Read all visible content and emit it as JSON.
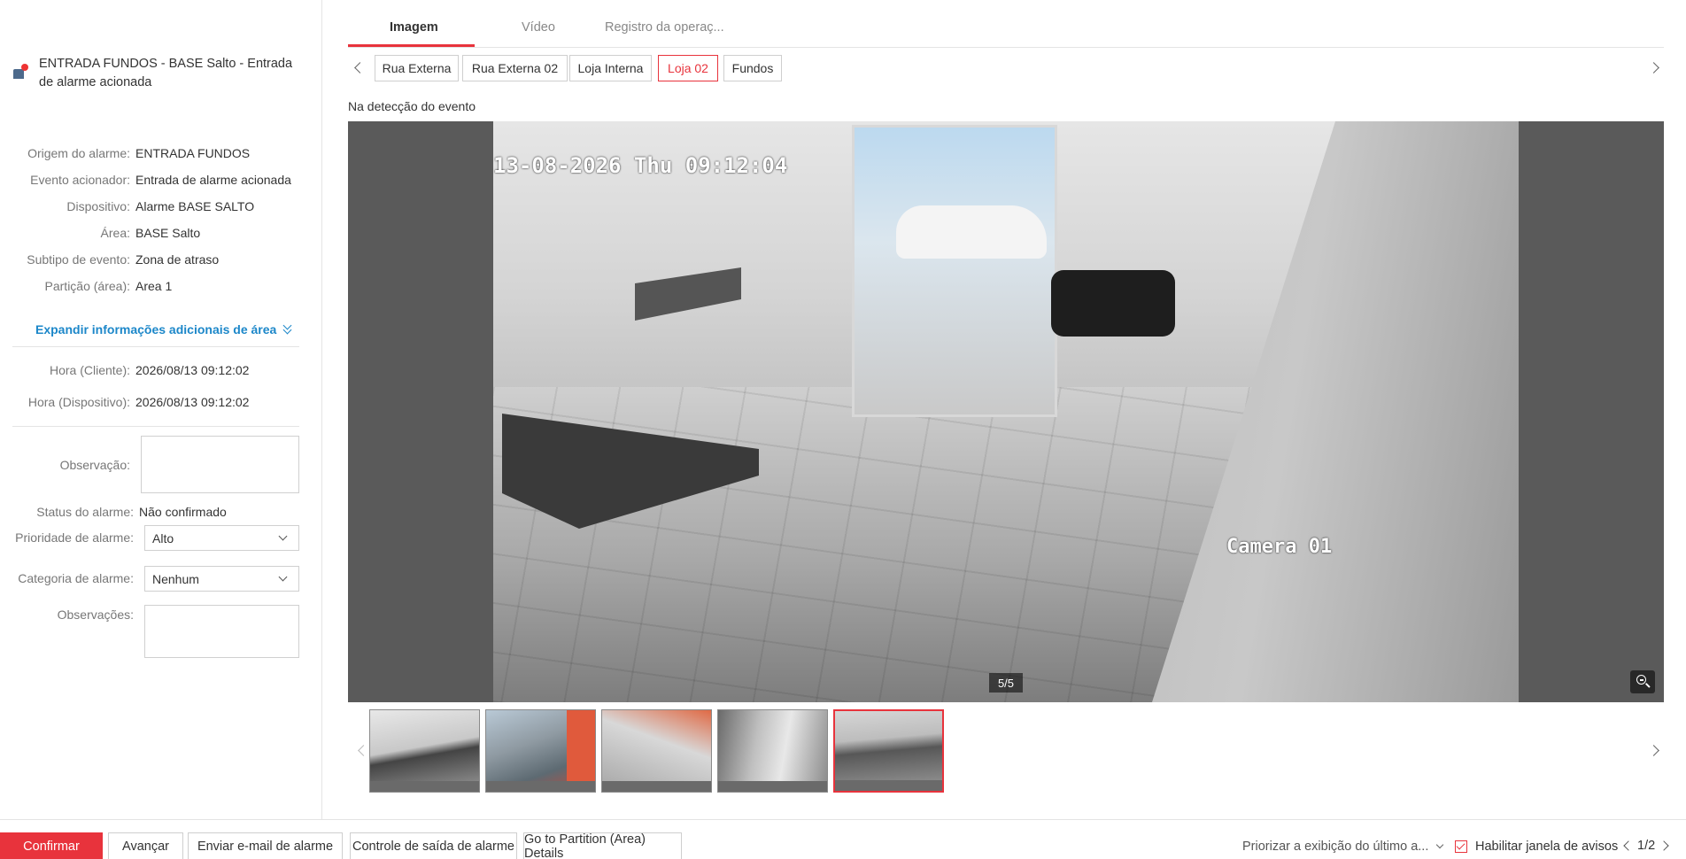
{
  "alarm": {
    "title": "ENTRADA FUNDOS - BASE Salto - Entrada de alarme acionada"
  },
  "details": {
    "origem_label": "Origem do alarme:",
    "origem_value": "ENTRADA FUNDOS",
    "evento_label": "Evento acionador:",
    "evento_value": "Entrada de alarme acionada",
    "dispositivo_label": "Dispositivo:",
    "dispositivo_value": "Alarme BASE SALTO",
    "area_label": "Área:",
    "area_value": "BASE Salto",
    "subtipo_label": "Subtipo de evento:",
    "subtipo_value": "Zona de atraso",
    "particao_label": "Partição (área):",
    "particao_value": "Area 1"
  },
  "expand_label": "Expandir informações adicionais de área",
  "times": {
    "cliente_label": "Hora (Cliente):",
    "cliente_value": "2026/08/13 09:12:02",
    "dispositivo_label": "Hora (Dispositivo):",
    "dispositivo_value": "2026/08/13 09:12:02"
  },
  "form": {
    "observacao_label": "Observação:",
    "status_label": "Status do alarme:",
    "status_value": "Não confirmado",
    "prioridade_label": "Prioridade de alarme:",
    "prioridade_value": "Alto",
    "categoria_label": "Categoria de alarme:",
    "categoria_value": "Nenhum",
    "observacoes_label": "Observações:"
  },
  "tabs": [
    "Imagem",
    "Vídeo",
    "Registro da operaç..."
  ],
  "cameras": [
    "Rua Externa",
    "Rua Externa 02",
    "Loja Interna",
    "Loja 02",
    "Fundos"
  ],
  "active_camera": "Loja 02",
  "event_label": "Na detecção do evento",
  "viewer": {
    "osd_time": "13-08-2026 Thu 09:12:04",
    "osd_camera": "Camera 01",
    "counter": "5/5"
  },
  "thumbnails_count": 5,
  "bottom": {
    "confirm": "Confirmar",
    "advance": "Avançar",
    "email": "Enviar e-mail de alarme",
    "output": "Controle de saída de alarme",
    "partition": "Go to Partition (Area) Details",
    "priority_view": "Priorizar a exibição do último a...",
    "enable_popup": "Habilitar janela de avisos",
    "page": "1/2"
  },
  "colors": {
    "accent": "#e8333c",
    "link": "#1c87c9"
  }
}
